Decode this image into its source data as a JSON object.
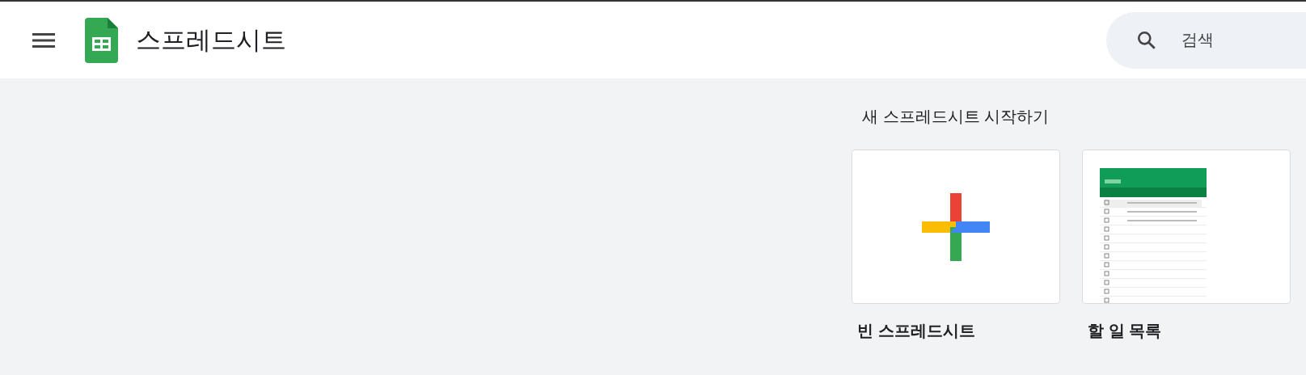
{
  "header": {
    "title": "스프레드시트",
    "search": {
      "placeholder": "검색"
    }
  },
  "templates": {
    "heading": "새 스프레드시트 시작하기",
    "items": [
      {
        "kind": "blank",
        "label": "빈 스프레드시트"
      },
      {
        "kind": "preview",
        "label": "할 일 목록"
      }
    ]
  }
}
